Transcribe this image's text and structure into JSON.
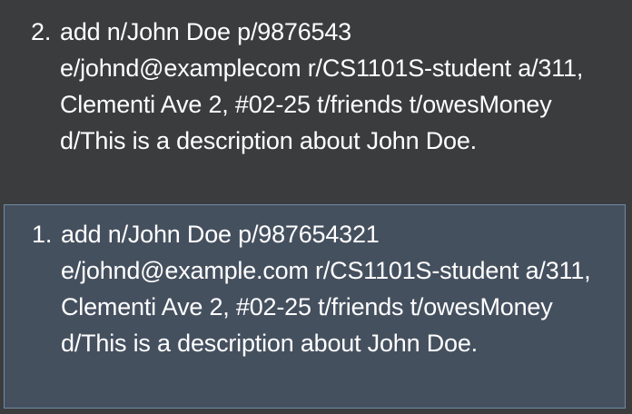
{
  "command_history": {
    "items": [
      {
        "index": "2.",
        "text": "add n/John Doe p/9876543 e/johnd@examplecom r/CS1101S-student a/311, Clementi Ave 2, #02-25 t/friends t/owesMoney d/This is a description about John Doe.",
        "selected": false
      },
      {
        "index": "1.",
        "text": "add n/John Doe p/987654321 e/johnd@example.com r/CS1101S-student a/311, Clementi Ave 2, #02-25 t/friends t/owesMoney d/This is a description about John Doe.",
        "selected": true
      }
    ]
  },
  "colors": {
    "background": "#3b3c3e",
    "selected_background": "#45505f",
    "selected_border": "#6f8aa3",
    "text": "#ffffff"
  }
}
